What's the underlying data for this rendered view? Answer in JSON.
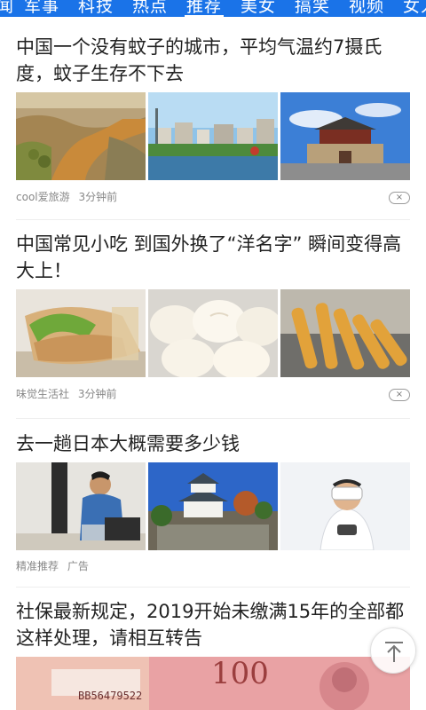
{
  "tabs": [
    {
      "label": "闻"
    },
    {
      "label": "军事"
    },
    {
      "label": "科技"
    },
    {
      "label": "热点"
    },
    {
      "label": "推荐",
      "active": true
    },
    {
      "label": "美女"
    },
    {
      "label": "搞笑"
    },
    {
      "label": "视频"
    },
    {
      "label": "女人"
    }
  ],
  "articles": [
    {
      "title": "中国一个没有蚊子的城市，平均气温约7摄氏度，蚊子生存不下去",
      "source": "cool爱旅游",
      "time": "3分钟前",
      "dismiss": "×"
    },
    {
      "title": "中国常见小吃 到国外换了“洋名字” 瞬间变得高大上！",
      "source": "味觉生活社",
      "time": "3分钟前",
      "dismiss": "×"
    },
    {
      "title": "去一趟日本大概需要多少钱",
      "source": "精准推荐",
      "tag": "广告"
    },
    {
      "title": "社保最新规定，2019开始未缴满15年的全部都这样处理，请相互转告",
      "banknote_serial": "BB56479522",
      "banknote_value": "100"
    }
  ],
  "colors": {
    "tabbar_bg": "#1a73e8",
    "meta_text": "#888888"
  }
}
